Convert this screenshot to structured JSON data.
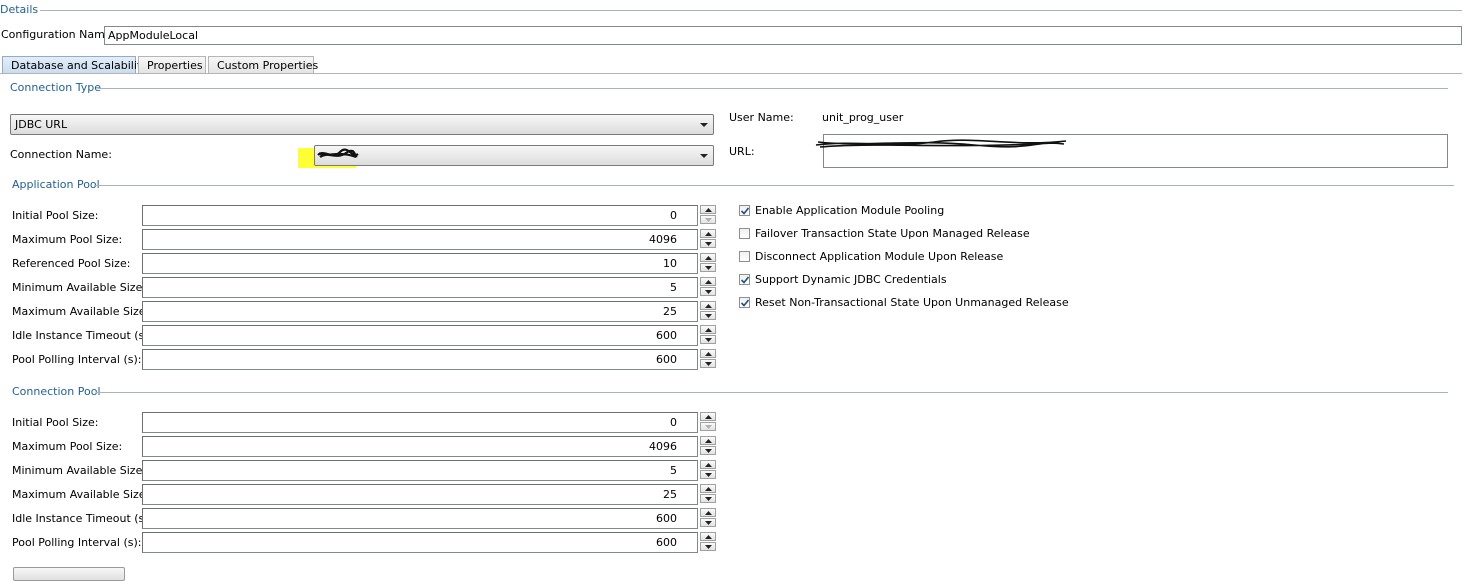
{
  "details": {
    "title": "Details",
    "config_label": "Configuration Name:",
    "config_value": "AppModuleLocal"
  },
  "tabs": [
    {
      "label": "Database and Scalability"
    },
    {
      "label": "Properties"
    },
    {
      "label": "Custom Properties"
    }
  ],
  "connection_type": {
    "title": "Connection Type",
    "type_value": "JDBC URL",
    "connection_name_label": "Connection Name:",
    "user_name_label": "User Name:",
    "user_name_value": "unit_prog_user",
    "url_label": "URL:"
  },
  "application_pool": {
    "title": "Application Pool",
    "fields": [
      {
        "label": "Initial Pool Size:",
        "value": "0"
      },
      {
        "label": "Maximum Pool Size:",
        "value": "4096"
      },
      {
        "label": "Referenced Pool Size:",
        "value": "10"
      },
      {
        "label": "Minimum Available Size:",
        "value": "5"
      },
      {
        "label": "Maximum Available Size:",
        "value": "25"
      },
      {
        "label": "Idle Instance Timeout (s):",
        "value": "600"
      },
      {
        "label": "Pool Polling Interval (s):",
        "value": "600"
      }
    ],
    "checkboxes": [
      {
        "label": "Enable Application Module Pooling",
        "checked": true
      },
      {
        "label": "Failover Transaction State Upon Managed Release",
        "checked": false
      },
      {
        "label": "Disconnect Application Module Upon Release",
        "checked": false
      },
      {
        "label": "Support Dynamic JDBC Credentials",
        "checked": true
      },
      {
        "label": "Reset Non-Transactional State Upon Unmanaged Release",
        "checked": true
      }
    ]
  },
  "connection_pool": {
    "title": "Connection Pool",
    "fields": [
      {
        "label": "Initial Pool Size:",
        "value": "0"
      },
      {
        "label": "Maximum Pool Size:",
        "value": "4096"
      },
      {
        "label": "Minimum Available Size:",
        "value": "5"
      },
      {
        "label": "Maximum Available Size:",
        "value": "25"
      },
      {
        "label": "Idle Instance Timeout (s):",
        "value": "600"
      },
      {
        "label": "Pool Polling Interval (s):",
        "value": "600"
      }
    ]
  },
  "colors": {
    "section_title": "#1f5f9e",
    "checkmark": "#1f4f8f",
    "highlight": "#ffff33"
  },
  "icons": {
    "combo_arrow": "chevron-down-icon",
    "spin_up": "spin-up-icon",
    "spin_down": "spin-down-icon",
    "check": "checkmark-icon"
  }
}
